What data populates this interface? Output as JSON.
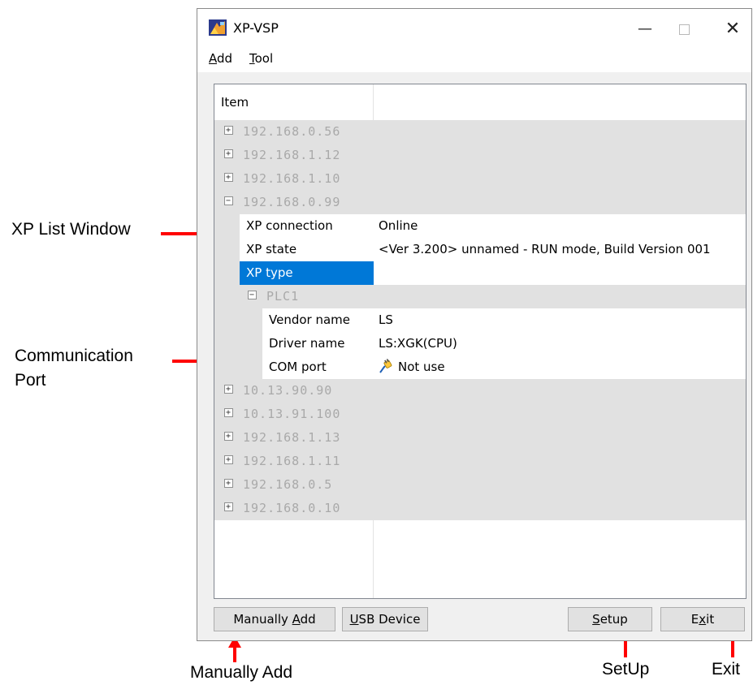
{
  "annotations": {
    "xp_list_window": "XP List Window",
    "communication_port_line1": "Communication",
    "communication_port_line2": "Port",
    "manually_add": "Manually Add",
    "setup": "SetUp",
    "exit": "Exit",
    "arrow_color": "#ff0000"
  },
  "window": {
    "title": "XP-VSP",
    "minimize_glyph": "—",
    "close_glyph": "✕"
  },
  "menu": {
    "add": {
      "mnemonic": "A",
      "rest": "dd"
    },
    "tool": {
      "mnemonic": "T",
      "rest": "ool"
    }
  },
  "list": {
    "header": "Item",
    "groups_before": [
      {
        "toggle": "+",
        "label": "192.168.0.56"
      },
      {
        "toggle": "+",
        "label": "192.168.1.12"
      },
      {
        "toggle": "+",
        "label": "192.168.1.10"
      },
      {
        "toggle": "−",
        "label": "192.168.0.99"
      }
    ],
    "expanded_props": [
      {
        "name": "XP connection",
        "value": "Online"
      },
      {
        "name": "XP state",
        "value": "<Ver 3.200> unnamed - RUN mode, Build Version 001"
      },
      {
        "name": "XP type",
        "value": ""
      }
    ],
    "plc": {
      "toggle": "−",
      "label": "PLC1"
    },
    "plc_props": [
      {
        "name": "Vendor name",
        "value": "LS"
      },
      {
        "name": "Driver name",
        "value": "LS:XGK(CPU)"
      },
      {
        "name": "COM port",
        "value": "Not use",
        "icon": "plug-icon"
      }
    ],
    "groups_after": [
      {
        "toggle": "+",
        "label": "10.13.90.90"
      },
      {
        "toggle": "+",
        "label": "10.13.91.100"
      },
      {
        "toggle": "+",
        "label": "192.168.1.13"
      },
      {
        "toggle": "+",
        "label": "192.168.1.11"
      },
      {
        "toggle": "+",
        "label": "192.168.0.5"
      },
      {
        "toggle": "+",
        "label": "192.168.0.10"
      }
    ],
    "selected_color": "#0078d7",
    "group_bg": "#e1e1e1"
  },
  "buttons": {
    "manually_add": {
      "before": "Manually ",
      "mnemonic": "A",
      "after": "dd"
    },
    "usb_device": {
      "before": "",
      "mnemonic": "U",
      "after": "SB Device"
    },
    "setup": {
      "before": "",
      "mnemonic": "S",
      "after": "etup"
    },
    "exit": {
      "before": "E",
      "mnemonic": "x",
      "after": "it"
    }
  }
}
